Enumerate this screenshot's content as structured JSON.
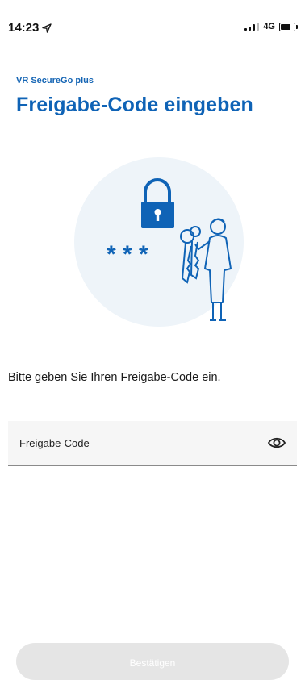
{
  "status_bar": {
    "time": "14:23",
    "network": "4G",
    "icons": [
      "location-arrow-icon",
      "signal-icon",
      "battery-icon"
    ]
  },
  "header": {
    "app_name": "VR SecureGo plus",
    "title": "Freigabe-Code eingeben"
  },
  "illustration": {
    "masked_code": "* * *",
    "icons": [
      "padlock-icon",
      "keys-icon",
      "person-icon"
    ]
  },
  "main": {
    "instruction": "Bitte geben Sie Ihren Freigabe-Code ein.",
    "code_field": {
      "placeholder": "Freigabe-Code",
      "value": "",
      "icon": "eye-icon"
    },
    "confirm_label": "Bestätigen"
  },
  "colors": {
    "accent": "#0f63b6",
    "illustration_bg": "#eef4f9",
    "button_disabled_bg": "#e5e5e5"
  }
}
